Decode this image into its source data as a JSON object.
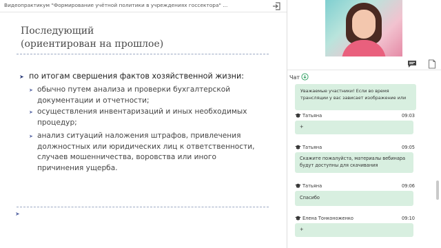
{
  "header": {
    "title": "Видеопрактикум \"Формирование учётной политики в учреждениях госсектора\" ...",
    "exit_icon": "exit-icon"
  },
  "slide": {
    "heading_line1": "Последующий",
    "heading_line2": "(ориентирован на прошлое)",
    "bullet": "по итогам свершения фактов хозяйственной жизни:",
    "subbullets": [
      "обычно путем анализа и проверки бухгалтерской документации и отчетности;",
      "осуществления инвентаризаций и иных необходимых процедур;",
      "анализ ситуаций наложения штрафов, привлечения должностных или юридических лиц к ответственности, случаев мошенничества, воровства или иного причинения ущерба."
    ],
    "bullet_mark": "➤",
    "sub_mark": "➤",
    "nav_mark": "➤"
  },
  "sidebar": {
    "chat_label": "Чат",
    "tab_icons": [
      "chat-icon",
      "document-icon"
    ]
  },
  "chat": {
    "first_message": "Уважаемые участники! Если во время трансляции у вас зависает изображение или",
    "messages": [
      {
        "name": "Татьяна",
        "time": "09:03",
        "text": "+"
      },
      {
        "name": "Татьяна",
        "time": "09:05",
        "text": "Скажите пожалуйста, материалы вебинара будут доступны для скачивания"
      },
      {
        "name": "Татьяна",
        "time": "09:06",
        "text": "Спасибо"
      },
      {
        "name": "Елена Тонконоженко",
        "time": "09:10",
        "text": "+"
      }
    ]
  },
  "colors": {
    "accent": "#2a3b78",
    "bubble": "#d8efe0",
    "dashed": "#9aa7c2"
  }
}
